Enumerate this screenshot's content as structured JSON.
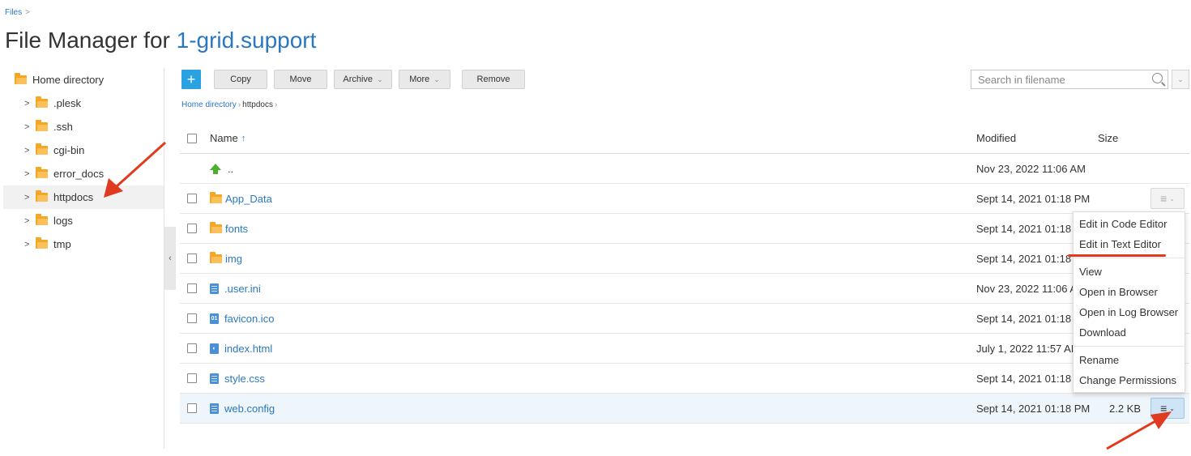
{
  "breadcrumb": {
    "files_label": "Files",
    "separator": ">"
  },
  "page_title": {
    "prefix": "File Manager for ",
    "domain": "1-grid.support"
  },
  "sidebar": {
    "root": "Home directory",
    "items": [
      {
        "label": ".plesk"
      },
      {
        "label": ".ssh"
      },
      {
        "label": "cgi-bin"
      },
      {
        "label": "error_docs"
      },
      {
        "label": "httpdocs"
      },
      {
        "label": "logs"
      },
      {
        "label": "tmp"
      }
    ],
    "collapse_glyph": "‹"
  },
  "toolbar": {
    "add_glyph": "+",
    "copy": "Copy",
    "move": "Move",
    "archive": "Archive",
    "more": "More",
    "remove": "Remove"
  },
  "search": {
    "placeholder": "Search in filename"
  },
  "path": {
    "home": "Home directory",
    "current": "httpdocs"
  },
  "table": {
    "columns": {
      "name": "Name",
      "sort_glyph": "↑",
      "modified": "Modified",
      "size": "Size"
    },
    "parent": {
      "name": "..",
      "modified": "Nov 23, 2022 11:06 AM"
    },
    "rows": [
      {
        "name": "App_Data",
        "modified": "Sept 14, 2021 01:18 PM",
        "size": ""
      },
      {
        "name": "fonts",
        "modified": "Sept 14, 2021 01:18 PM",
        "size": ""
      },
      {
        "name": "img",
        "modified": "Sept 14, 2021 01:18 PM",
        "size": ""
      },
      {
        "name": ".user.ini",
        "modified": "Nov 23, 2022 11:06 AM",
        "size": ""
      },
      {
        "name": "favicon.ico",
        "modified": "Sept 14, 2021 01:18 PM",
        "size": ""
      },
      {
        "name": "index.html",
        "modified": "July 1, 2022 11:57 AM",
        "size": ""
      },
      {
        "name": "style.css",
        "modified": "Sept 14, 2021 01:18 PM",
        "size": ""
      },
      {
        "name": "web.config",
        "modified": "Sept 14, 2021 01:18 PM",
        "size": "2.2 KB"
      }
    ],
    "favicon_badge": "01"
  },
  "context_menu": {
    "edit_code": "Edit in Code Editor",
    "edit_text": "Edit in Text Editor",
    "view": "View",
    "open_browser": "Open in Browser",
    "open_log": "Open in Log Browser",
    "download": "Download",
    "rename": "Rename",
    "change_permissions": "Change Permissions"
  },
  "colors": {
    "accent": "#2a78c2",
    "add_button": "#2aa1e0",
    "folder": "#f5a623",
    "annotation": "#e03a1f"
  }
}
